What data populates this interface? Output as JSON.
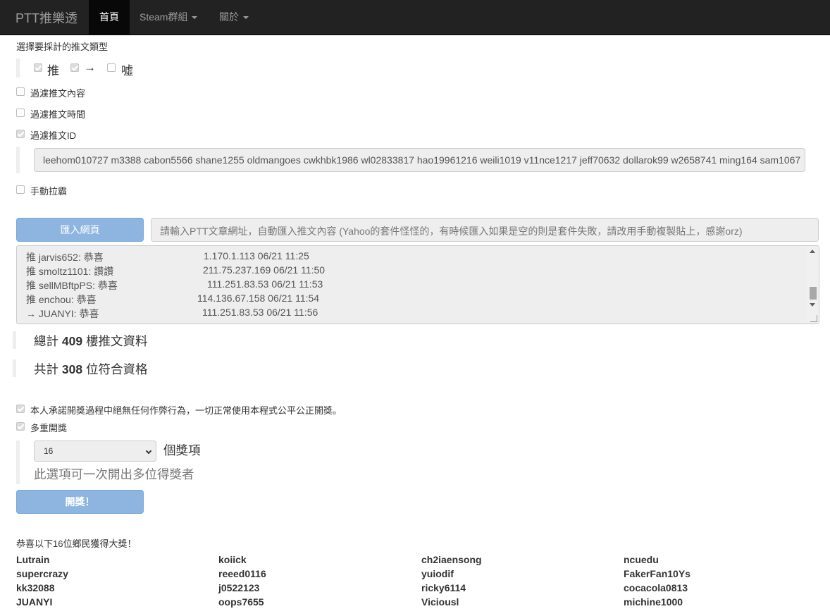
{
  "navbar": {
    "brand": "PTT推樂透",
    "items": [
      {
        "label": "首頁",
        "active": true
      },
      {
        "label": "Steam群組",
        "dropdown": true
      },
      {
        "label": "關於",
        "dropdown": true
      }
    ]
  },
  "push_types": {
    "heading": "選擇要採計的推文類型",
    "options": [
      {
        "label": "推",
        "checked": true
      },
      {
        "label": "→",
        "checked": true
      },
      {
        "label": "噓",
        "checked": false
      }
    ]
  },
  "filters": {
    "content": {
      "label": "過濾推文內容",
      "checked": false
    },
    "time": {
      "label": "過濾推文時間",
      "checked": false
    },
    "id": {
      "label": "過濾推文ID",
      "checked": true
    }
  },
  "filter_ids": "leehom010727 m3388 cabon5566 shane1255 oldmangoes cwkhbk1986 wl02833817 hao19961216 weili1019 v11nce1217 jeff70632 dollarok99 w2658741 ming164 sam1067",
  "manual_pull": {
    "label": "手動拉霸",
    "checked": false
  },
  "import": {
    "button_label": "匯入網頁",
    "url_placeholder": "請輸入PTT文章網址，自動匯入推文內容 (Yahoo的套件怪怪的，有時候匯入如果是空的則是套件失敗，請改用手動複製貼上，感謝orz)"
  },
  "comments": [
    {
      "text": "推 jarvis652: 恭喜",
      "meta": "1.170.1.113 06/21 11:25"
    },
    {
      "text": "推 smoltz1101: 讚讚",
      "meta": "211.75.237.169 06/21 11:50"
    },
    {
      "text": "推 sellMBftpPS: 恭喜",
      "meta": "111.251.83.53 06/21 11:53"
    },
    {
      "text": "推 enchou: 恭喜",
      "meta": "114.136.67.158 06/21 11:54"
    },
    {
      "text": "→ JUANYI: 恭喜",
      "meta": "111.251.83.53 06/21 11:56"
    }
  ],
  "stats": {
    "total_prefix": "總計",
    "total_count": "409",
    "total_suffix": "樓推文資料",
    "qualified_prefix": "共計",
    "qualified_count": "308",
    "qualified_suffix": "位符合資格"
  },
  "promise": {
    "label": "本人承諾開獎過程中絕無任何作弊行為，一切正常使用本程式公平公正開獎。",
    "checked": true
  },
  "multi_draw": {
    "label": "多重開獎",
    "checked": true
  },
  "prize_count": {
    "value": "16",
    "suffix": "個獎項",
    "hint": "此選項可一次開出多位得獎者"
  },
  "draw_button": "開獎！",
  "result_heading": "恭喜以下16位鄉民獲得大獎！",
  "winners": [
    [
      "Lutrain",
      "koiick",
      "ch2iaensong",
      "ncuedu"
    ],
    [
      "supercrazy",
      "reeed0116",
      "yuiodif",
      "FakerFan10Ys"
    ],
    [
      "kk32088",
      "j0522123",
      "ricky6114",
      "cocacola0813"
    ],
    [
      "JUANYI",
      "oops7655",
      "Viciousl",
      "michine1000"
    ]
  ]
}
